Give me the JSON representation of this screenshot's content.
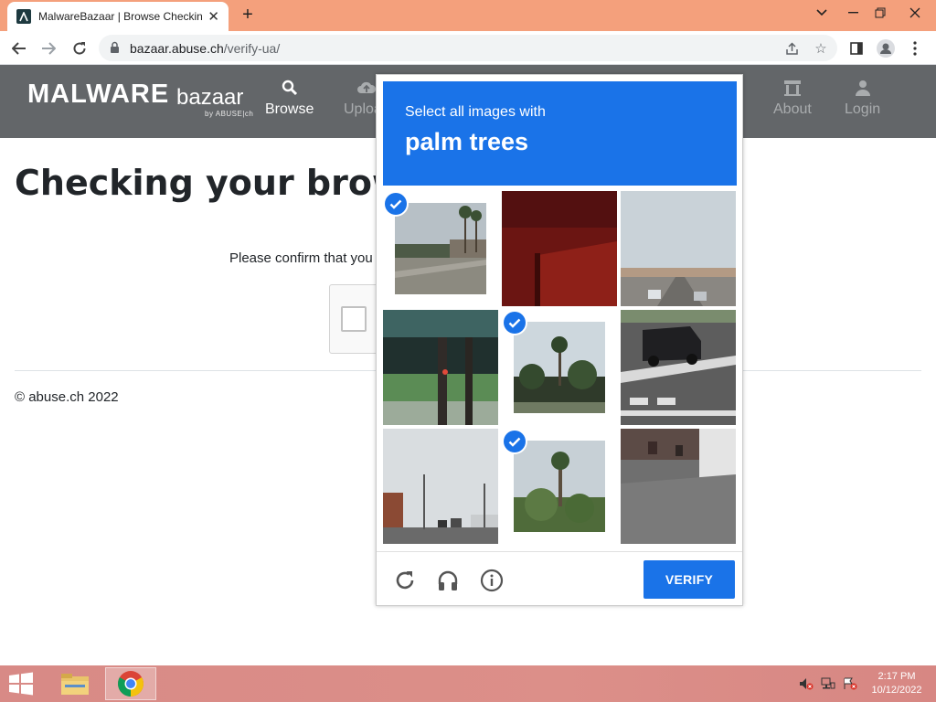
{
  "browser": {
    "tab_title": "MalwareBazaar | Browse Checking",
    "url_host": "bazaar.abuse.ch",
    "url_path": "/verify-ua/"
  },
  "site": {
    "logo_main": "MALWARE",
    "logo_sub": "bazaar",
    "logo_by": "by ABUSE|ch",
    "nav": {
      "browse": "Browse",
      "upload": "Upload",
      "about": "About",
      "login": "Login"
    }
  },
  "page": {
    "title": "Checking your browser",
    "confirm_text": "Please confirm that you",
    "footer": "© abuse.ch 2022"
  },
  "captcha": {
    "instruction": "Select all images with",
    "target": "palm trees",
    "tiles": [
      {
        "selected": true
      },
      {
        "selected": false
      },
      {
        "selected": false
      },
      {
        "selected": false
      },
      {
        "selected": true
      },
      {
        "selected": false
      },
      {
        "selected": false
      },
      {
        "selected": true
      },
      {
        "selected": false
      }
    ],
    "verify_label": "VERIFY",
    "accent_color": "#1a73e8"
  },
  "taskbar": {
    "time": "2:17 PM",
    "date": "10/12/2022"
  },
  "colors": {
    "tabstrip": "#f4a07c",
    "site_header": "#636669",
    "taskbar": "#d88a86"
  }
}
